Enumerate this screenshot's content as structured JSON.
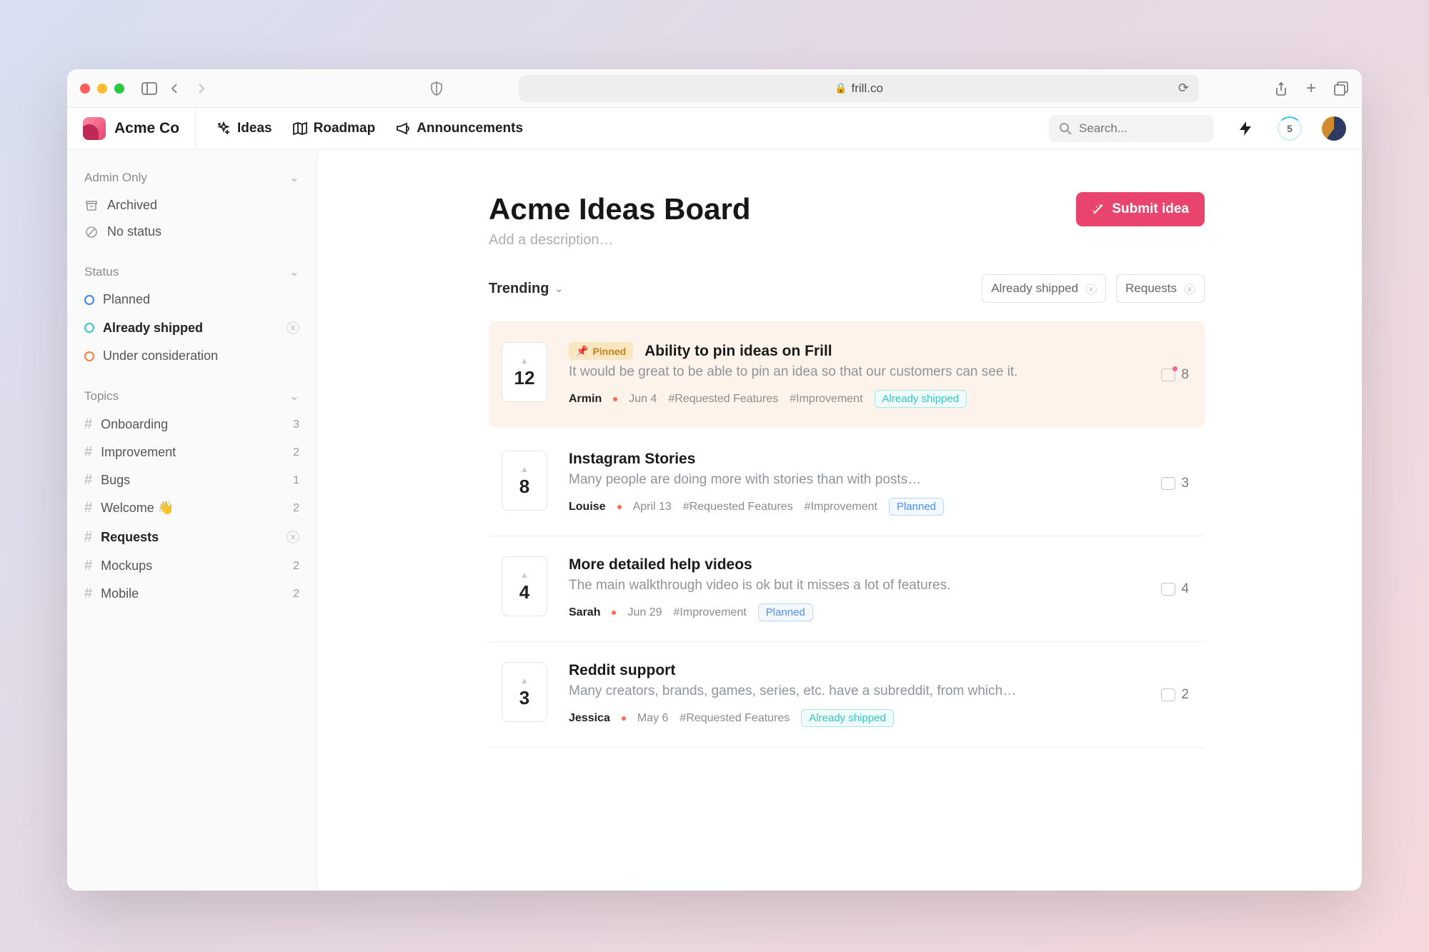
{
  "browser": {
    "url_host": "frill.co"
  },
  "app": {
    "brand": "Acme Co",
    "nav": {
      "ideas": "Ideas",
      "roadmap": "Roadmap",
      "announcements": "Announcements"
    },
    "search_placeholder": "Search...",
    "badge_count": "5"
  },
  "sidebar": {
    "admin": {
      "heading": "Admin Only",
      "archived": "Archived",
      "no_status": "No status"
    },
    "status": {
      "heading": "Status",
      "planned": "Planned",
      "shipped": "Already shipped",
      "consider": "Under consideration"
    },
    "topics": {
      "heading": "Topics",
      "items": [
        {
          "label": "Onboarding",
          "count": "3"
        },
        {
          "label": "Improvement",
          "count": "2"
        },
        {
          "label": "Bugs",
          "count": "1"
        },
        {
          "label": "Welcome 👋",
          "count": "2"
        },
        {
          "label": "Requests",
          "count": ""
        },
        {
          "label": "Mockups",
          "count": "2"
        },
        {
          "label": "Mobile",
          "count": "2"
        }
      ]
    }
  },
  "board": {
    "title": "Acme Ideas Board",
    "desc_placeholder": "Add a description…",
    "submit_label": "Submit idea",
    "sort_label": "Trending",
    "filters": {
      "shipped": "Already shipped",
      "requests": "Requests"
    }
  },
  "ideas": [
    {
      "votes": "12",
      "pinned_label": "Pinned",
      "title": "Ability to pin ideas on Frill",
      "excerpt": "It would be great to be able to pin an idea so that our customers can see it.",
      "author": "Armin",
      "date": "Jun 4",
      "tags": [
        "#Requested Features",
        "#Improvement"
      ],
      "status": "Already shipped",
      "status_kind": "shipped",
      "comments": "8",
      "pinned": true
    },
    {
      "votes": "8",
      "title": "Instagram Stories",
      "excerpt": "Many people are doing more with stories than with posts…",
      "author": "Louise",
      "date": "April 13",
      "tags": [
        "#Requested Features",
        "#Improvement"
      ],
      "status": "Planned",
      "status_kind": "planned",
      "comments": "3"
    },
    {
      "votes": "4",
      "title": "More detailed help videos",
      "excerpt": "The main walkthrough video is ok but it misses a lot of features.",
      "author": "Sarah",
      "date": "Jun 29",
      "tags": [
        "#Improvement"
      ],
      "status": "Planned",
      "status_kind": "planned",
      "comments": "4"
    },
    {
      "votes": "3",
      "title": "Reddit support",
      "excerpt": "Many creators, brands, games, series, etc. have a subreddit, from which…",
      "author": "Jessica",
      "date": "May 6",
      "tags": [
        "#Requested Features"
      ],
      "status": "Already shipped",
      "status_kind": "shipped",
      "comments": "2"
    }
  ]
}
